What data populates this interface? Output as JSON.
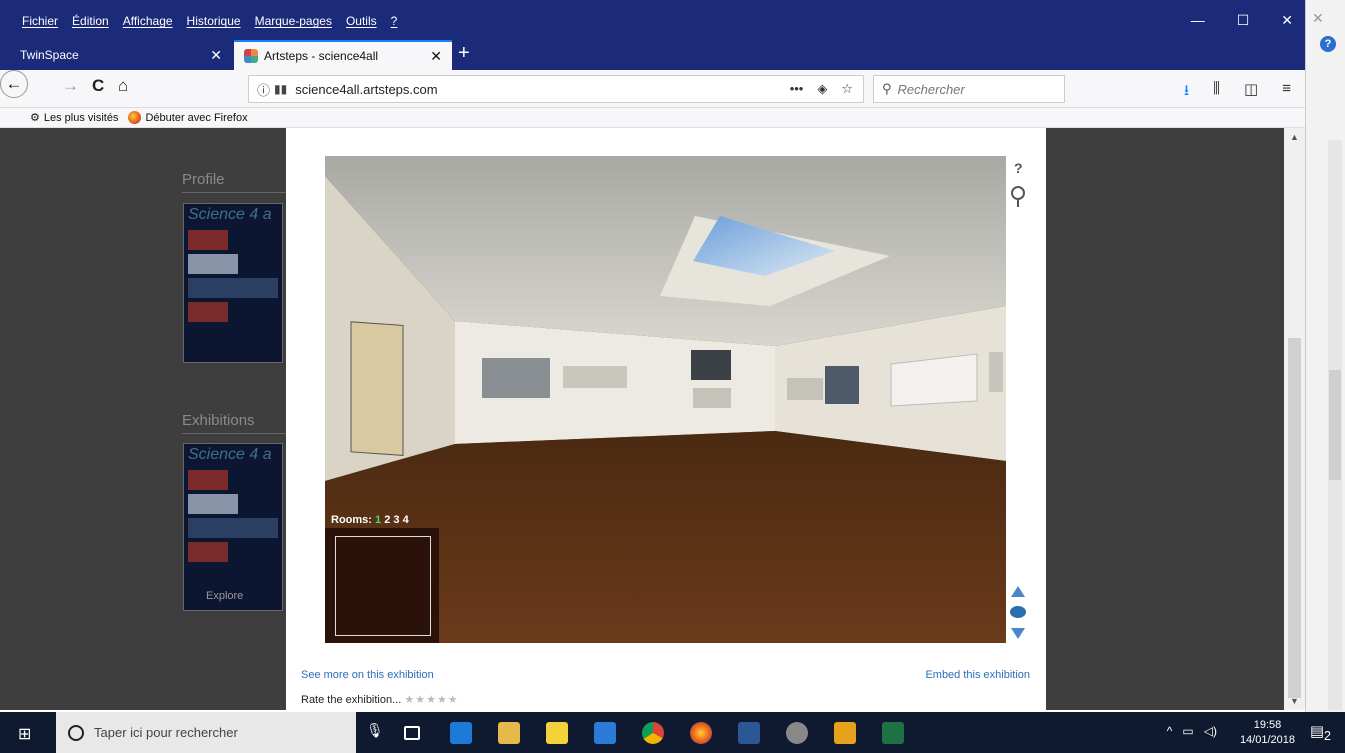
{
  "menu": [
    "Fichier",
    "Édition",
    "Affichage",
    "Historique",
    "Marque-pages",
    "Outils",
    "?"
  ],
  "window_controls": {
    "minimize": "—",
    "maximize": "☐",
    "close": "✕"
  },
  "tabs": [
    {
      "label": "TwinSpace",
      "close": "✕"
    },
    {
      "label": "Artsteps - science4all",
      "close": "✕"
    }
  ],
  "new_tab": "+",
  "nav": {
    "back": "←",
    "forward": "→",
    "reload": "C",
    "home": "⌂"
  },
  "urlbar": {
    "url": "science4all.artsteps.com",
    "info": "ⓘ",
    "lock": "▮▮",
    "more": "•••",
    "pocket": "◈",
    "star": "☆"
  },
  "search": {
    "placeholder": "Rechercher",
    "glass": "⚲"
  },
  "toolbar_icons": {
    "download": "⭳",
    "library": "⫼",
    "sidebar": "◫",
    "hamburger": "≡"
  },
  "bookmarks": [
    "Les plus visités",
    "Débuter avec Firefox"
  ],
  "background_page": {
    "profile_heading": "Profile",
    "exhibitions_heading": "Exhibitions",
    "thumb_title": "Science 4 a",
    "explore": "Explore"
  },
  "viewer": {
    "rooms_label": "Rooms:",
    "rooms": [
      "1",
      "2",
      "3",
      "4"
    ],
    "help": "?"
  },
  "links": {
    "see_more": "See more on this exhibition",
    "embed": "Embed this exhibition"
  },
  "rating": {
    "label": "Rate the exhibition...",
    "stars": "★★★★★",
    "value": 0,
    "max": 5
  },
  "taskbar": {
    "search_placeholder": "Taper ici pour rechercher",
    "time": "19:58",
    "date": "14/01/2018",
    "notifications": "2"
  },
  "colors": {
    "titlebar": "#1c2a7a",
    "link": "#2a6fb8",
    "room_active": "#4cd964",
    "taskbar": "#0f1a30"
  }
}
